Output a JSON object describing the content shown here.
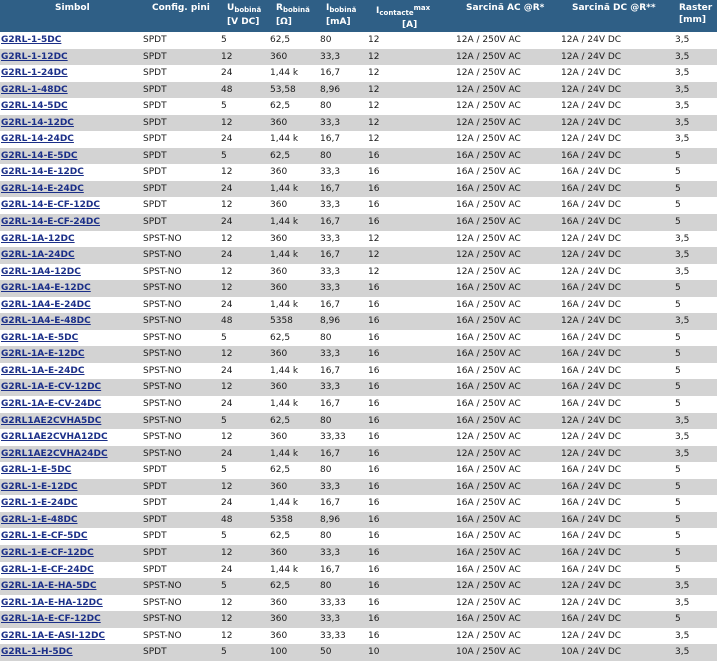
{
  "header": {
    "simbol": "Simbol",
    "config": "Config. pini",
    "u_main": "U",
    "u_sub": "bobină",
    "u_unit": "[V DC]",
    "r_main": "R",
    "r_sub": "bobină",
    "r_unit": "[Ω]",
    "i_main": "I",
    "i_sub": "bobină",
    "i_unit": "[mA]",
    "ic_main": "I",
    "ic_sub": "contacte",
    "ic_sup": "max",
    "ic_unit": "[A]",
    "ac": "Sarcină AC @R*",
    "dc": "Sarcină DC @R**",
    "raster": "Raster",
    "raster_unit": "[mm]"
  },
  "rows": [
    [
      "G2RL-1-5DC",
      "SPDT",
      "5",
      "62,5",
      "80",
      "12",
      "12A / 250V AC",
      "12A / 24V DC",
      "3,5"
    ],
    [
      "G2RL-1-12DC",
      "SPDT",
      "12",
      "360",
      "33,3",
      "12",
      "12A / 250V AC",
      "12A / 24V DC",
      "3,5"
    ],
    [
      "G2RL-1-24DC",
      "SPDT",
      "24",
      "1,44 k",
      "16,7",
      "12",
      "12A / 250V AC",
      "12A / 24V DC",
      "3,5"
    ],
    [
      "G2RL-1-48DC",
      "SPDT",
      "48",
      "53,58",
      "8,96",
      "12",
      "12A / 250V AC",
      "12A / 24V DC",
      "3,5"
    ],
    [
      "G2RL-14-5DC",
      "SPDT",
      "5",
      "62,5",
      "80",
      "12",
      "12A / 250V AC",
      "12A / 24V DC",
      "3,5"
    ],
    [
      "G2RL-14-12DC",
      "SPDT",
      "12",
      "360",
      "33,3",
      "12",
      "12A / 250V AC",
      "12A / 24V DC",
      "3,5"
    ],
    [
      "G2RL-14-24DC",
      "SPDT",
      "24",
      "1,44 k",
      "16,7",
      "12",
      "12A / 250V AC",
      "12A / 24V DC",
      "3,5"
    ],
    [
      "G2RL-14-E-5DC",
      "SPDT",
      "5",
      "62,5",
      "80",
      "16",
      "16A / 250V AC",
      "16A / 24V DC",
      "5"
    ],
    [
      "G2RL-14-E-12DC",
      "SPDT",
      "12",
      "360",
      "33,3",
      "16",
      "16A / 250V AC",
      "16A / 24V DC",
      "5"
    ],
    [
      "G2RL-14-E-24DC",
      "SPDT",
      "24",
      "1,44 k",
      "16,7",
      "16",
      "16A / 250V AC",
      "16A / 24V DC",
      "5"
    ],
    [
      "G2RL-14-E-CF-12DC",
      "SPDT",
      "12",
      "360",
      "33,3",
      "16",
      "16A / 250V AC",
      "16A / 24V DC",
      "5"
    ],
    [
      "G2RL-14-E-CF-24DC",
      "SPDT",
      "24",
      "1,44 k",
      "16,7",
      "16",
      "16A / 250V AC",
      "16A / 24V DC",
      "5"
    ],
    [
      "G2RL-1A-12DC",
      "SPST-NO",
      "12",
      "360",
      "33,3",
      "12",
      "12A / 250V AC",
      "12A / 24V DC",
      "3,5"
    ],
    [
      "G2RL-1A-24DC",
      "SPST-NO",
      "24",
      "1,44 k",
      "16,7",
      "12",
      "12A / 250V AC",
      "12A / 24V DC",
      "3,5"
    ],
    [
      "G2RL-1A4-12DC",
      "SPST-NO",
      "12",
      "360",
      "33,3",
      "12",
      "12A / 250V AC",
      "12A / 24V DC",
      "3,5"
    ],
    [
      "G2RL-1A4-E-12DC",
      "SPST-NO",
      "12",
      "360",
      "33,3",
      "16",
      "16A / 250V AC",
      "16A / 24V DC",
      "5"
    ],
    [
      "G2RL-1A4-E-24DC",
      "SPST-NO",
      "24",
      "1,44 k",
      "16,7",
      "16",
      "16A / 250V AC",
      "16A / 24V DC",
      "5"
    ],
    [
      "G2RL-1A4-E-48DC",
      "SPST-NO",
      "48",
      "5358",
      "8,96",
      "16",
      "16A / 250V AC",
      "12A / 24V DC",
      "3,5"
    ],
    [
      "G2RL-1A-E-5DC",
      "SPST-NO",
      "5",
      "62,5",
      "80",
      "16",
      "16A / 250V AC",
      "16A / 24V DC",
      "5"
    ],
    [
      "G2RL-1A-E-12DC",
      "SPST-NO",
      "12",
      "360",
      "33,3",
      "16",
      "16A / 250V AC",
      "16A / 24V DC",
      "5"
    ],
    [
      "G2RL-1A-E-24DC",
      "SPST-NO",
      "24",
      "1,44 k",
      "16,7",
      "16",
      "16A / 250V AC",
      "16A / 24V DC",
      "5"
    ],
    [
      "G2RL-1A-E-CV-12DC",
      "SPST-NO",
      "12",
      "360",
      "33,3",
      "16",
      "16A / 250V AC",
      "16A / 24V DC",
      "5"
    ],
    [
      "G2RL-1A-E-CV-24DC",
      "SPST-NO",
      "24",
      "1,44 k",
      "16,7",
      "16",
      "16A / 250V AC",
      "16A / 24V DC",
      "5"
    ],
    [
      "G2RL1AE2CVHA5DC",
      "SPST-NO",
      "5",
      "62,5",
      "80",
      "16",
      "16A / 250V AC",
      "12A / 24V DC",
      "3,5"
    ],
    [
      "G2RL1AE2CVHA12DC",
      "SPST-NO",
      "12",
      "360",
      "33,33",
      "16",
      "12A / 250V AC",
      "12A / 24V DC",
      "3,5"
    ],
    [
      "G2RL1AE2CVHA24DC",
      "SPST-NO",
      "24",
      "1,44 k",
      "16,7",
      "16",
      "12A / 250V AC",
      "12A / 24V DC",
      "3,5"
    ],
    [
      "G2RL-1-E-5DC",
      "SPDT",
      "5",
      "62,5",
      "80",
      "16",
      "16A / 250V AC",
      "16A / 24V DC",
      "5"
    ],
    [
      "G2RL-1-E-12DC",
      "SPDT",
      "12",
      "360",
      "33,3",
      "16",
      "16A / 250V AC",
      "16A / 24V DC",
      "5"
    ],
    [
      "G2RL-1-E-24DC",
      "SPDT",
      "24",
      "1,44 k",
      "16,7",
      "16",
      "16A / 250V AC",
      "16A / 24V DC",
      "5"
    ],
    [
      "G2RL-1-E-48DC",
      "SPDT",
      "48",
      "5358",
      "8,96",
      "16",
      "16A / 250V AC",
      "16A / 24V DC",
      "5"
    ],
    [
      "G2RL-1-E-CF-5DC",
      "SPDT",
      "5",
      "62,5",
      "80",
      "16",
      "16A / 250V AC",
      "16A / 24V DC",
      "5"
    ],
    [
      "G2RL-1-E-CF-12DC",
      "SPDT",
      "12",
      "360",
      "33,3",
      "16",
      "16A / 250V AC",
      "16A / 24V DC",
      "5"
    ],
    [
      "G2RL-1-E-CF-24DC",
      "SPDT",
      "24",
      "1,44 k",
      "16,7",
      "16",
      "16A / 250V AC",
      "16A / 24V DC",
      "5"
    ],
    [
      "G2RL-1A-E-HA-5DC",
      "SPST-NO",
      "5",
      "62,5",
      "80",
      "16",
      "12A / 250V AC",
      "12A / 24V DC",
      "3,5"
    ],
    [
      "G2RL-1A-E-HA-12DC",
      "SPST-NO",
      "12",
      "360",
      "33,33",
      "16",
      "12A / 250V AC",
      "12A / 24V DC",
      "3,5"
    ],
    [
      "G2RL-1A-E-CF-12DC",
      "SPST-NO",
      "12",
      "360",
      "33,3",
      "16",
      "16A / 250V AC",
      "16A / 24V DC",
      "5"
    ],
    [
      "G2RL-1A-E-ASI-12DC",
      "SPST-NO",
      "12",
      "360",
      "33,33",
      "16",
      "12A / 250V AC",
      "12A / 24V DC",
      "3,5"
    ],
    [
      "G2RL-1-H-5DC",
      "SPDT",
      "5",
      "100",
      "50",
      "10",
      "10A / 250V AC",
      "10A / 24V DC",
      "3,5"
    ]
  ]
}
